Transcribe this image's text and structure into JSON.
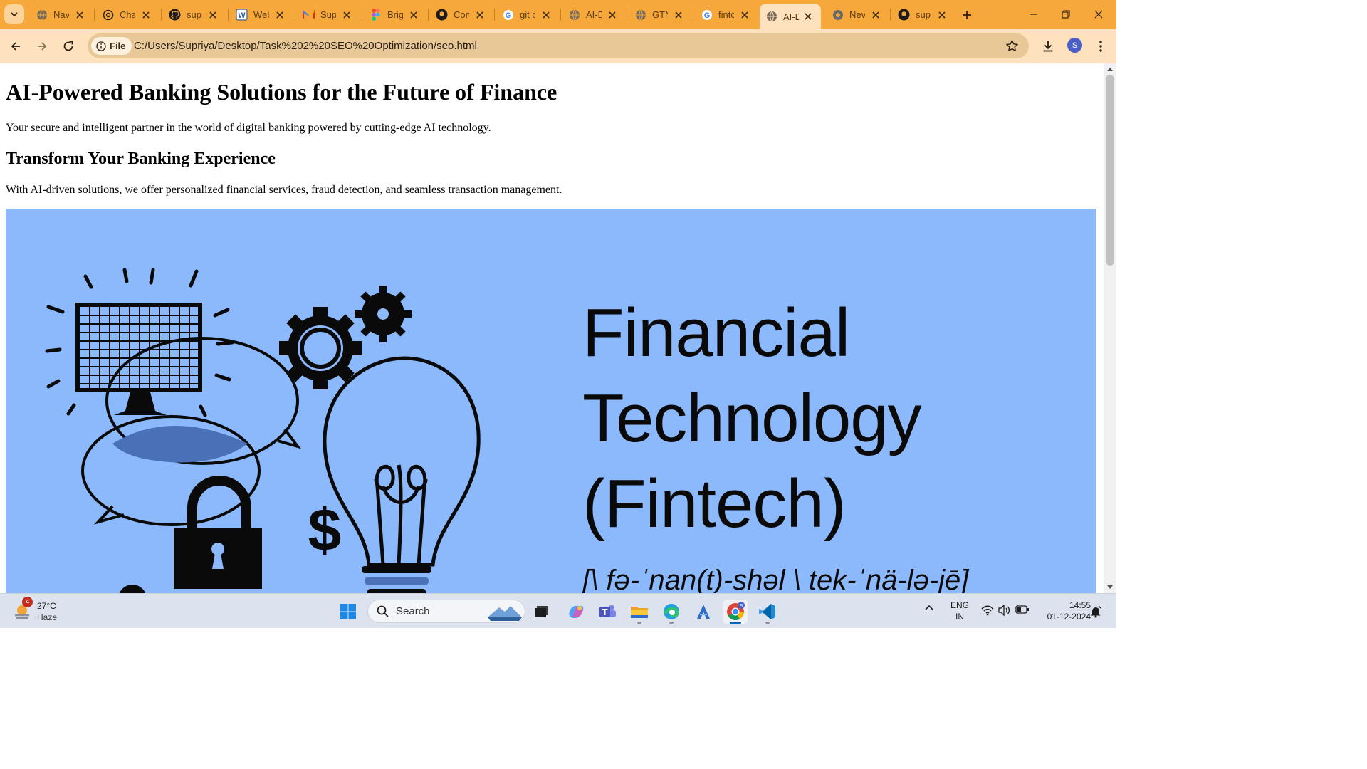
{
  "browser": {
    "tabs": [
      {
        "title": "Navi",
        "favicon": "globe-icon",
        "active": false
      },
      {
        "title": "Chat",
        "favicon": "openai-icon",
        "active": false
      },
      {
        "title": "supr",
        "favicon": "github-icon",
        "active": false
      },
      {
        "title": "Web",
        "favicon": "word-icon",
        "active": false
      },
      {
        "title": "Sup",
        "favicon": "gmail-icon",
        "active": false
      },
      {
        "title": "Brig",
        "favicon": "figma-icon",
        "active": false
      },
      {
        "title": "Con",
        "favicon": "github-icon",
        "active": false
      },
      {
        "title": "git c",
        "favicon": "google-icon",
        "active": false
      },
      {
        "title": "AI-D",
        "favicon": "globe-icon",
        "active": false
      },
      {
        "title": "GTN",
        "favicon": "globe-icon",
        "active": false
      },
      {
        "title": "fintc",
        "favicon": "google-icon",
        "active": false
      },
      {
        "title": "AI-D",
        "favicon": "globe-icon",
        "active": true
      },
      {
        "title": "Nev",
        "favicon": "chrome-icon",
        "active": false
      },
      {
        "title": "sup",
        "favicon": "github-icon",
        "active": false
      }
    ],
    "site_chip_label": "File",
    "url": "C:/Users/Supriya/Desktop/Task%202%20SEO%20Optimization/seo.html",
    "profile_initial": "S",
    "theme_color": "#f6a83a"
  },
  "page": {
    "heading": "AI-Powered Banking Solutions for the Future of Finance",
    "intro": "Your secure and intelligent partner in the world of digital banking powered by cutting-edge AI technology.",
    "section_heading": "Transform Your Banking Experience",
    "section_text": "With AI-driven solutions, we offer personalized financial services, fraud detection, and seamless transaction management.",
    "hero": {
      "line1": "Financial",
      "line2": "Technology",
      "line3": "(Fintech)",
      "pronunciation": "[\\ fə-ˈnan(t)-shəl \\ tek-ˈnä-lə-jē]",
      "background": "#8cb9fb"
    }
  },
  "taskbar": {
    "weather_temp": "27°C",
    "weather_condition": "Haze",
    "weather_badge": "4",
    "search_label": "Search",
    "language_line1": "ENG",
    "language_line2": "IN",
    "time": "14:55",
    "date": "01-12-2024",
    "apps": [
      "start-button",
      "file-explorer",
      "copilot",
      "teams",
      "files",
      "edge",
      "azure-data-studio",
      "chrome",
      "vscode"
    ]
  }
}
